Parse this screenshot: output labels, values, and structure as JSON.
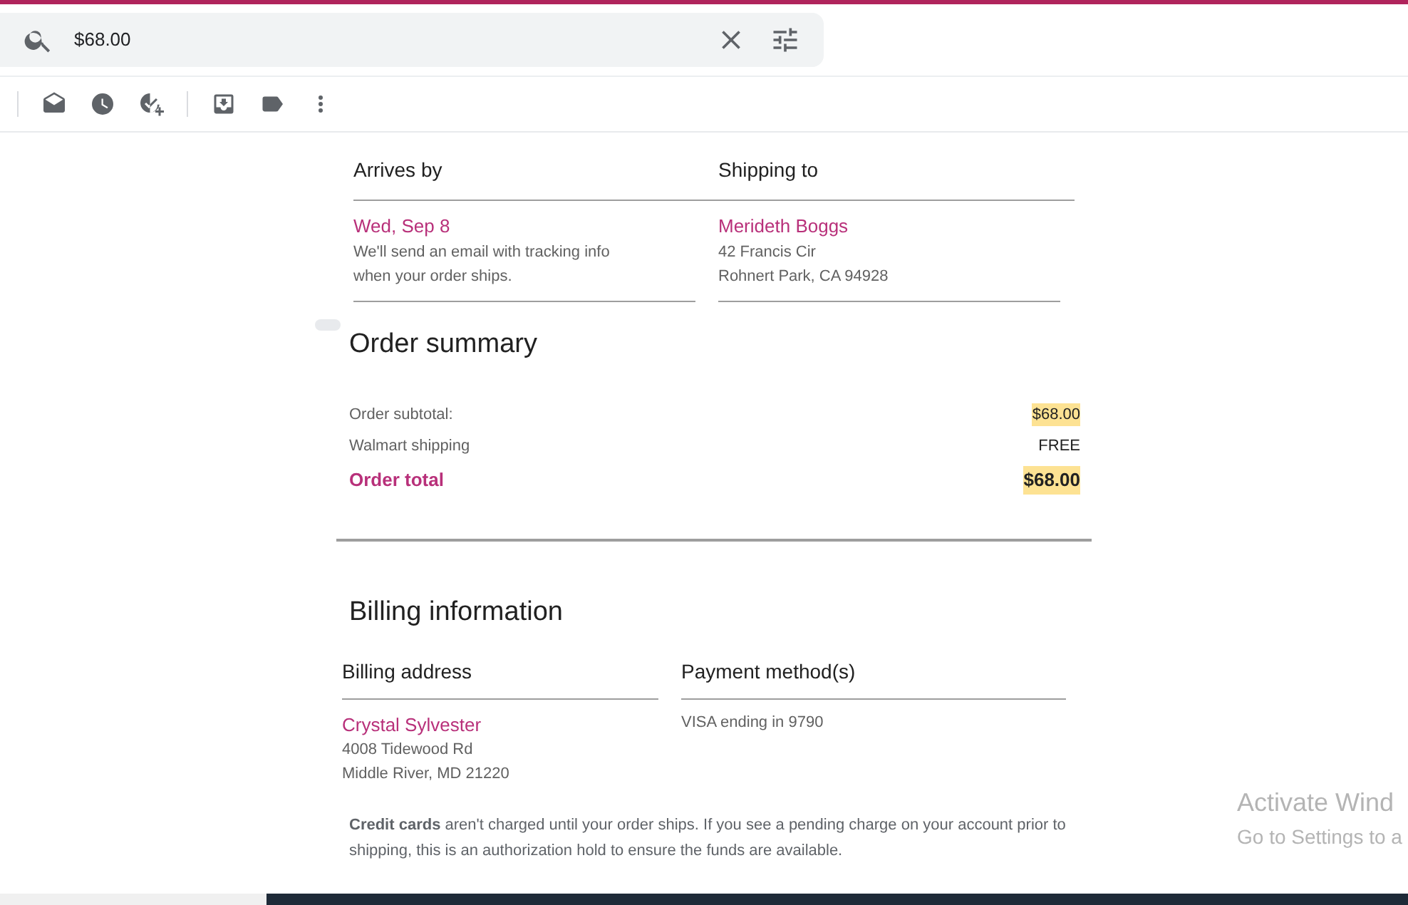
{
  "search": {
    "value": "$68.00"
  },
  "delivery": [
    {
      "heading": "Arrives by",
      "title": "Wed, Sep 8",
      "lines": [
        "We'll send an email with tracking info",
        "when your order ships."
      ]
    },
    {
      "heading": "Shipping to",
      "title": "Merideth Boggs",
      "lines": [
        "42 Francis Cir",
        "Rohnert Park, CA 94928"
      ]
    }
  ],
  "order_summary": {
    "heading": "Order summary",
    "rows": [
      {
        "kind": "line",
        "label": "Order subtotal:",
        "value": "$68.00",
        "highlighted": true
      },
      {
        "kind": "line",
        "label": "Walmart shipping",
        "value": "FREE",
        "highlighted": false
      },
      {
        "kind": "total",
        "label": "Order total",
        "value": "$68.00",
        "highlighted": true
      }
    ]
  },
  "billing": {
    "heading": "Billing information",
    "columns": [
      {
        "heading": "Billing address",
        "title": "Crystal Sylvester",
        "lines": [
          "4008 Tidewood Rd",
          "Middle River, MD 21220"
        ]
      },
      {
        "heading": "Payment method(s)",
        "lines": [
          "VISA ending in 9790"
        ]
      }
    ],
    "note": "**Credit cards** aren't charged until your order ships. If you see a pending charge on your account prior to shipping, this is an authorization hold to ensure the funds are available."
  },
  "os_notice": {
    "title": "Activate Wind",
    "subtitle": "Go to Settings to a"
  }
}
